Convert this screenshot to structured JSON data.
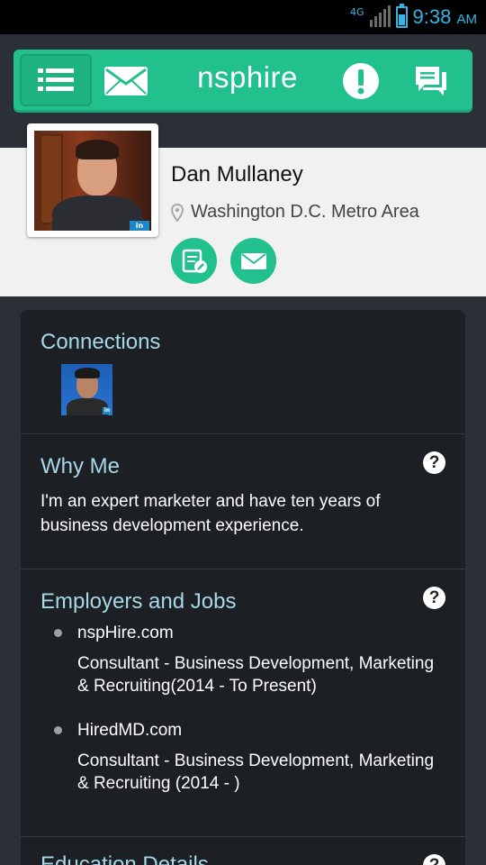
{
  "status_bar": {
    "network": "4G",
    "time": "9:38",
    "ampm": "AM"
  },
  "nav": {
    "brand": "nsphire"
  },
  "profile": {
    "name": "Dan Mullaney",
    "location": "Washington D.C. Metro Area",
    "photo_badge": "in"
  },
  "connections": {
    "title": "Connections",
    "badge": "in"
  },
  "why_me": {
    "title": "Why Me",
    "text": "I'm an expert marketer and have ten years of business development experience."
  },
  "employers": {
    "title": "Employers and Jobs",
    "items": [
      {
        "company": "nspHire.com",
        "role": "Consultant - Business Development, Marketing & Recruiting(2014 - To Present)"
      },
      {
        "company": "HiredMD.com",
        "role": "Consultant - Business Development, Marketing & Recruiting (2014 - )"
      }
    ]
  },
  "education": {
    "title": "Education Details"
  },
  "help_glyph": "?",
  "colors": {
    "accent": "#22c08c",
    "title_text": "#a6d8e6",
    "card_bg": "#1c1f24",
    "status_blue": "#33b5e5"
  }
}
